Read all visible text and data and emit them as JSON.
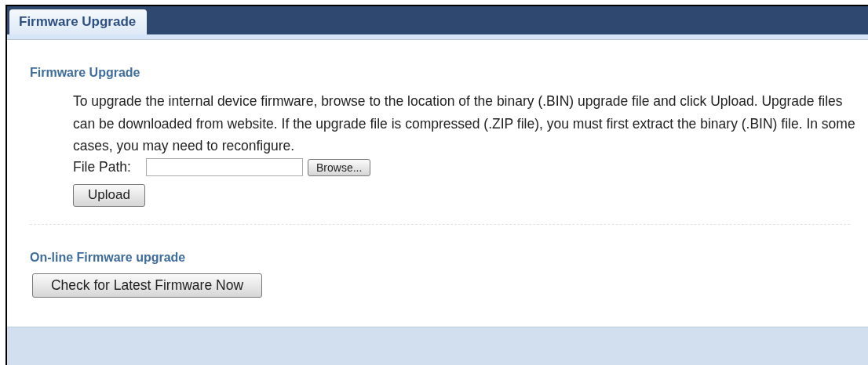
{
  "tabs": [
    {
      "label": "Firmware Upgrade",
      "selected": true
    }
  ],
  "firmware_upgrade": {
    "title": "Firmware Upgrade",
    "description": "To upgrade the internal device firmware, browse to the location of the binary (.BIN) upgrade file and click Upload. Upgrade files can be downloaded from website. If the upgrade file is compressed (.ZIP file), you must first extract the binary (.BIN) file. In some cases, you may need to reconfigure.",
    "file_path_label": "File Path:",
    "browse_button": "Browse...",
    "upload_button": "Upload"
  },
  "online_upgrade": {
    "title": "On-line Firmware upgrade",
    "check_button": "Check for Latest Firmware Now"
  }
}
